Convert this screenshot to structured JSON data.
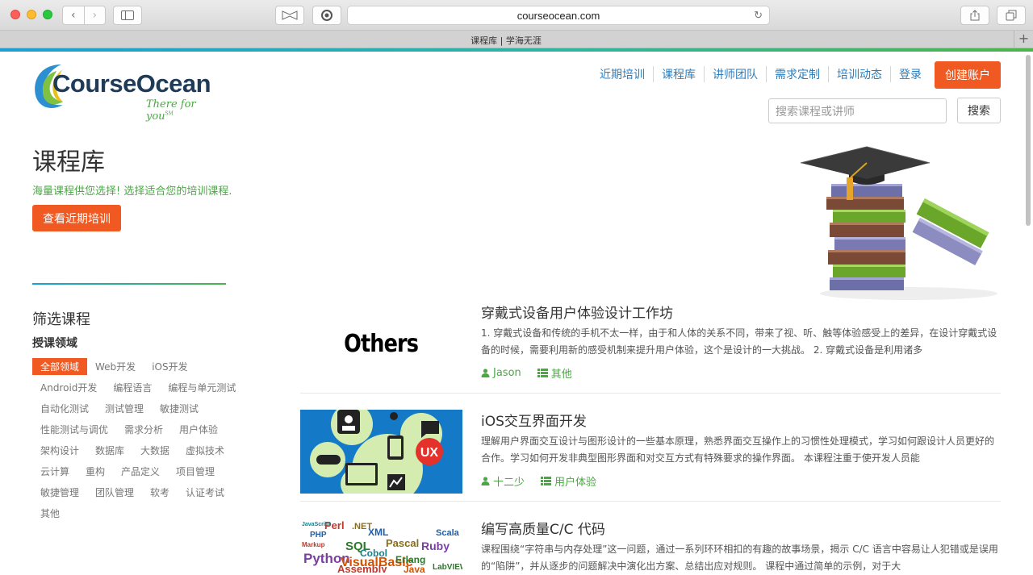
{
  "browser": {
    "url": "courseocean.com",
    "tab_title": "课程库 | 学海无涯"
  },
  "header": {
    "logo_text": "CourseOcean",
    "logo_tagline": "There for you",
    "logo_tm": "SM",
    "nav": [
      "近期培训",
      "课程库",
      "讲师团队",
      "需求定制",
      "培训动态",
      "登录"
    ],
    "create_account": "创建账户",
    "search_placeholder": "搜索课程或讲师",
    "search_button": "搜索"
  },
  "hero": {
    "title": "课程库",
    "subtitle": "海量课程供您选择! 选择适合您的培训课程.",
    "button": "查看近期培训"
  },
  "filter": {
    "title": "筛选课程",
    "subtitle": "授课领域",
    "tags": [
      "全部领域",
      "Web开发",
      "iOS开发",
      "Android开发",
      "编程语言",
      "编程与单元测试",
      "自动化测试",
      "测试管理",
      "敏捷测试",
      "性能测试与调优",
      "需求分析",
      "用户体验",
      "架构设计",
      "数据库",
      "大数据",
      "虚拟技术",
      "云计算",
      "重构",
      "产品定义",
      "项目管理",
      "敏捷管理",
      "团队管理",
      "软考",
      "认证考试",
      "其他"
    ],
    "active_tag": "全部领域"
  },
  "courses": [
    {
      "thumb_text": "Others",
      "title": "穿戴式设备用户体验设计工作坊",
      "description": "1. 穿戴式设备和传统的手机不太一样，由于和人体的关系不同，带来了视、听、触等体验感受上的差异，在设计穿戴式设备的时候，需要利用新的感受机制来提升用户体验，这个是设计的一大挑战。 2. 穿戴式设备是利用诸多",
      "teacher": "Jason",
      "category": "其他"
    },
    {
      "thumb_text": "UX",
      "title": "iOS交互界面开发",
      "description": "理解用户界面交互设计与图形设计的一些基本原理，熟悉界面交互操作上的习惯性处理模式，学习如何跟设计人员更好的合作。学习如何开发非典型图形界面和对交互方式有特殊要求的操作界面。 本课程注重于使开发人员能",
      "teacher": "十二少",
      "category": "用户体验"
    },
    {
      "thumb_words": [
        "Perl",
        "PHP",
        "SQL",
        "Python",
        "VisualBasic",
        "Cobol",
        "Pascal",
        "Assembly",
        "XML",
        "Erlang",
        "Ruby",
        "Java",
        "JavaScript",
        ".NET",
        "Markup",
        "Scala",
        "LabVIEW"
      ],
      "title": "编写高质量C/C 代码",
      "description": "课程围绕“字符串与内存处理”这一问题，通过一系列环环相扣的有趣的故事场景，揭示 C/C 语言中容易让人犯错或是误用的“陷阱”，并从逐步的问题解决中演化出方案、总结出应对规则。 课程中通过简单的示例，对于大"
    }
  ],
  "colors": {
    "accent_orange": "#f05a22",
    "link_blue": "#2a7fc0",
    "green": "#4aa843"
  }
}
